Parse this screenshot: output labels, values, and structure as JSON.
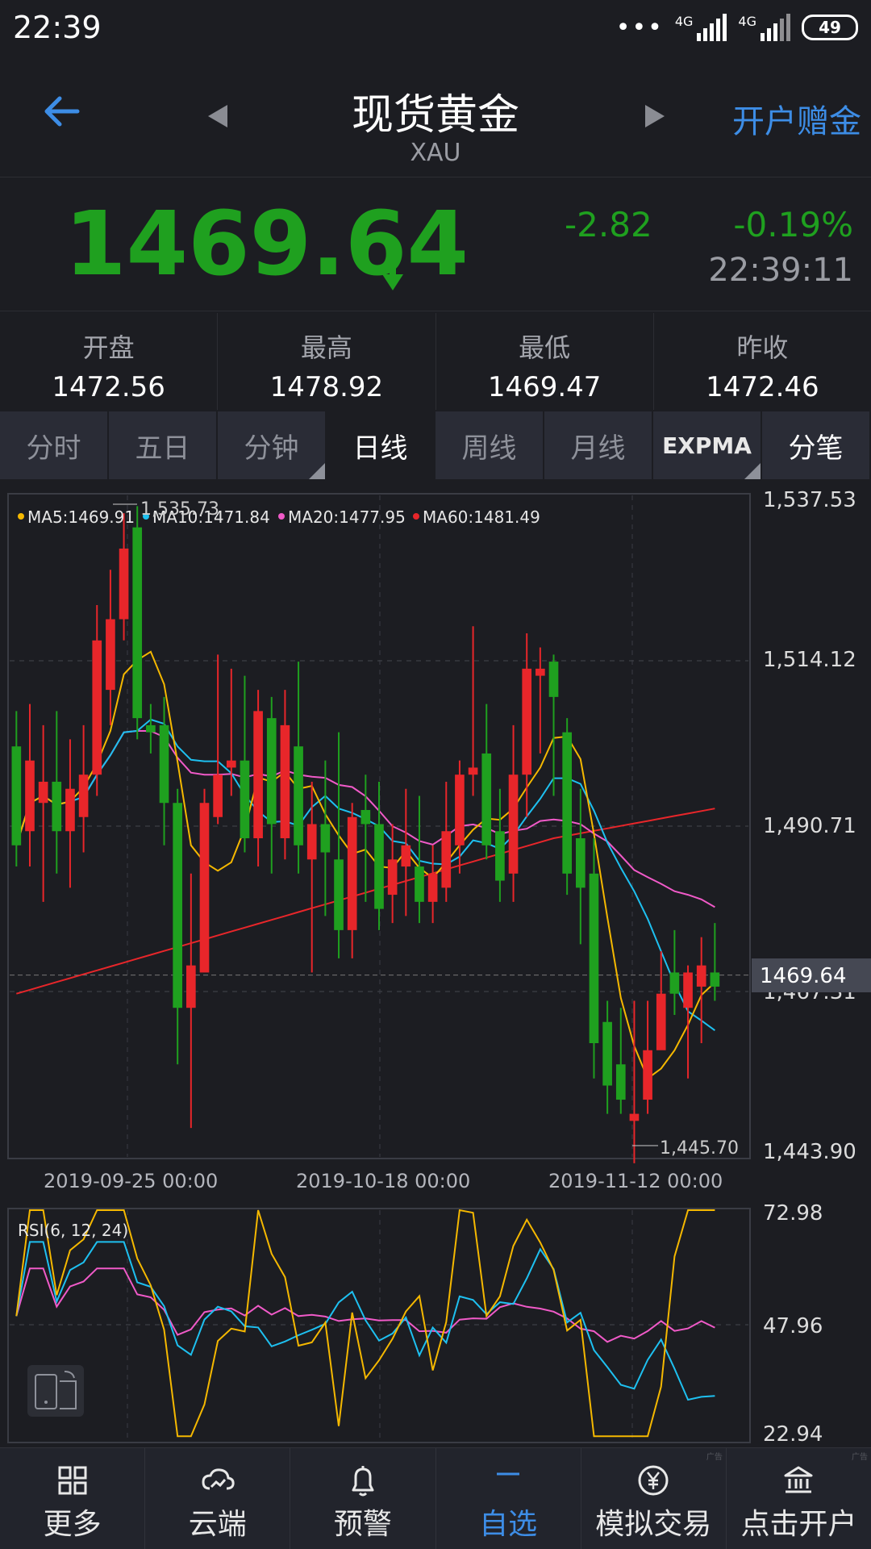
{
  "status_bar": {
    "time": "22:39",
    "dots": "•••",
    "net1": "4G",
    "net2": "4G",
    "battery": "49"
  },
  "header": {
    "title": "现货黄金",
    "subtitle": "XAU",
    "open_account": "开户赠金"
  },
  "quote": {
    "price": "1469.64",
    "change": "-2.82",
    "change_pct": "-0.19%",
    "time": "22:39:11",
    "color_down": "#1fa01f"
  },
  "stats": [
    {
      "label": "开盘",
      "value": "1472.56"
    },
    {
      "label": "最高",
      "value": "1478.92"
    },
    {
      "label": "最低",
      "value": "1469.47"
    },
    {
      "label": "昨收",
      "value": "1472.46"
    }
  ],
  "tabs": [
    {
      "label": "分时",
      "active": false
    },
    {
      "label": "五日",
      "active": false
    },
    {
      "label": "分钟",
      "active": false,
      "dropdown": true
    },
    {
      "label": "日线",
      "active": true
    },
    {
      "label": "周线",
      "active": false
    },
    {
      "label": "月线",
      "active": false
    },
    {
      "label": "EXPMA",
      "active": false,
      "dropdown": true
    },
    {
      "label": "分笔",
      "active": false
    }
  ],
  "legend": {
    "ma5": "MA5:1469.91",
    "ma10": "MA10:1471.84",
    "ma20": "MA20:1477.95",
    "ma60": "MA60:1481.49"
  },
  "axis": {
    "y_labels": [
      "1,537.53",
      "1,514.12",
      "1,490.71",
      "1,467.31",
      "1,443.90"
    ],
    "x_labels": [
      "2019-09-25 00:00",
      "2019-10-18 00:00",
      "2019-11-12 00:00"
    ],
    "current_price_tag": "1469.64",
    "high_marker": "1,535.73",
    "low_marker": "1,445.70"
  },
  "rsi": {
    "title": "RSI(6, 12, 24)",
    "y_labels": [
      "72.98",
      "47.96",
      "22.94"
    ]
  },
  "colors": {
    "up": "#e8262a",
    "down": "#1fa01f",
    "ma5": "#f5b800",
    "ma10": "#1ec0f0",
    "ma20": "#f05ac8",
    "ma60": "#e8262a",
    "accent": "#3d8de6"
  },
  "bottom_nav": [
    {
      "label": "更多",
      "icon": "grid-icon",
      "active": false
    },
    {
      "label": "云端",
      "icon": "cloud-icon",
      "active": false
    },
    {
      "label": "预警",
      "icon": "bell-icon",
      "active": false
    },
    {
      "label": "自选",
      "icon": "minus-icon",
      "active": true
    },
    {
      "label": "模拟交易",
      "icon": "yen-icon",
      "active": false
    },
    {
      "label": "点击开户",
      "icon": "bank-icon",
      "active": false
    }
  ],
  "ad_label": "广告",
  "chart_data": {
    "type": "candlestick",
    "ylim": [
      1443.9,
      1537.53
    ],
    "candles": [
      [
        1502,
        1488,
        1507,
        1485
      ],
      [
        1490,
        1500,
        1508,
        1485
      ],
      [
        1494,
        1497,
        1505,
        1480
      ],
      [
        1497,
        1490,
        1507,
        1484
      ],
      [
        1490,
        1496,
        1503,
        1482
      ],
      [
        1492,
        1498,
        1505,
        1487
      ],
      [
        1498,
        1517,
        1522,
        1495
      ],
      [
        1510,
        1520,
        1527,
        1505
      ],
      [
        1520,
        1530,
        1535,
        1517
      ],
      [
        1533,
        1506,
        1536,
        1503
      ],
      [
        1505,
        1504,
        1508,
        1501
      ],
      [
        1505,
        1494,
        1509,
        1488
      ],
      [
        1494,
        1465,
        1496,
        1457
      ],
      [
        1465,
        1471,
        1484,
        1448
      ],
      [
        1470,
        1494,
        1496,
        1474
      ],
      [
        1492,
        1498,
        1515,
        1491
      ],
      [
        1499,
        1500,
        1513,
        1495
      ],
      [
        1500,
        1489,
        1512,
        1487
      ],
      [
        1489,
        1507,
        1510,
        1485
      ],
      [
        1506,
        1491,
        1509,
        1484
      ],
      [
        1489,
        1505,
        1510,
        1486
      ],
      [
        1502,
        1488,
        1514,
        1484
      ],
      [
        1486,
        1491,
        1497,
        1470
      ],
      [
        1491,
        1487,
        1500,
        1478
      ],
      [
        1486,
        1476,
        1504,
        1472
      ],
      [
        1476,
        1492,
        1494,
        1472
      ],
      [
        1493,
        1491,
        1498,
        1480
      ],
      [
        1491,
        1479,
        1497,
        1476
      ],
      [
        1481,
        1486,
        1491,
        1477
      ],
      [
        1485,
        1488,
        1496,
        1478
      ],
      [
        1485,
        1480,
        1495,
        1477
      ],
      [
        1480,
        1484,
        1488,
        1477
      ],
      [
        1482,
        1490,
        1497,
        1480
      ],
      [
        1488,
        1498,
        1500,
        1484
      ],
      [
        1498,
        1499,
        1519,
        1495
      ],
      [
        1501,
        1488,
        1508,
        1486
      ],
      [
        1490,
        1483,
        1496,
        1480
      ],
      [
        1484,
        1498,
        1505,
        1480
      ],
      [
        1498,
        1513,
        1518,
        1492
      ],
      [
        1512,
        1513,
        1516,
        1501
      ],
      [
        1514,
        1509,
        1515,
        1495
      ],
      [
        1504,
        1484,
        1506,
        1481
      ],
      [
        1489,
        1482,
        1496,
        1474
      ],
      [
        1484,
        1460,
        1489,
        1455
      ],
      [
        1463,
        1454,
        1466,
        1450
      ],
      [
        1457,
        1452,
        1465,
        1450
      ],
      [
        1449,
        1450,
        1466,
        1443
      ],
      [
        1452,
        1459,
        1466,
        1450
      ],
      [
        1459,
        1467,
        1473,
        1465
      ],
      [
        1470,
        1467,
        1476,
        1464
      ],
      [
        1465,
        1470,
        1471,
        1455
      ],
      [
        1468,
        1471,
        1475,
        1460
      ],
      [
        1470,
        1468,
        1477,
        1466
      ]
    ]
  }
}
